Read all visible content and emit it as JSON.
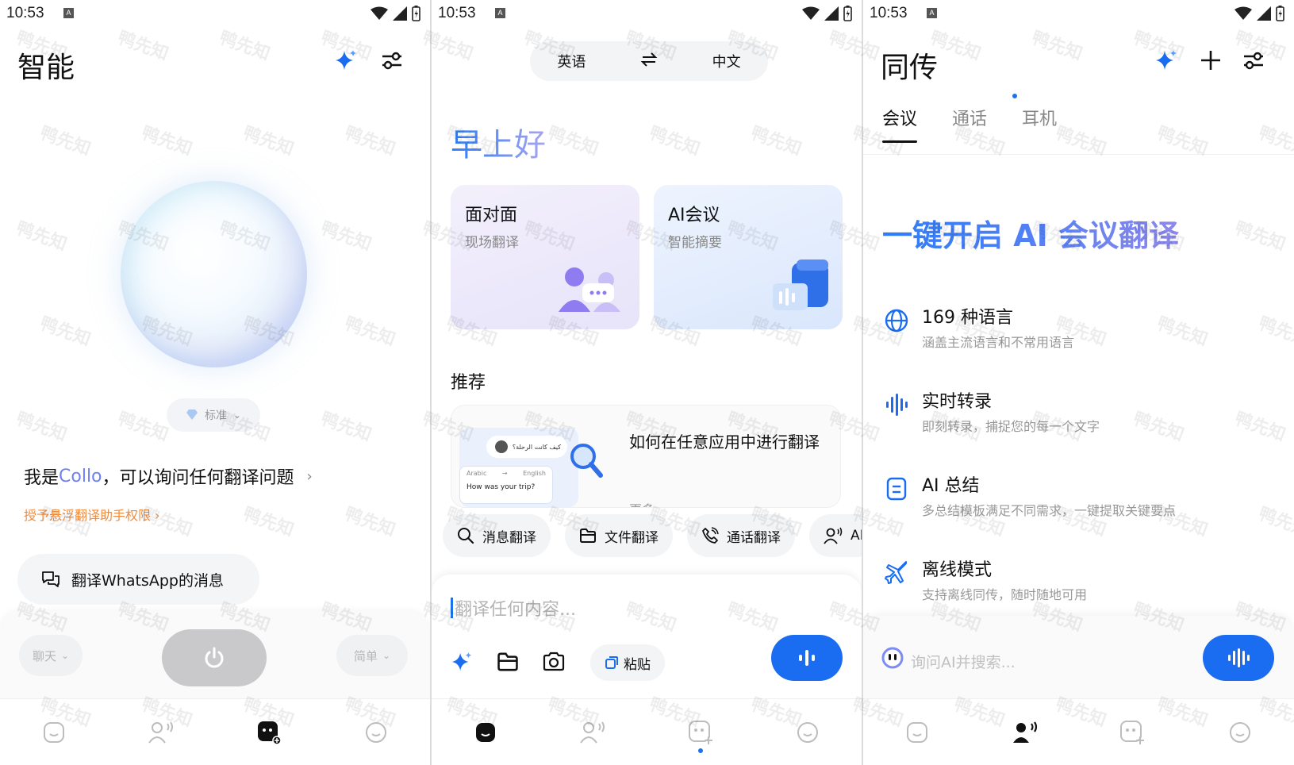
{
  "watermark": "鸭先知",
  "status": {
    "time": "10:53",
    "badge": "A"
  },
  "colors": {
    "accent": "#1a6cf0",
    "collo": "#6e7ff7",
    "orange": "#f08a3d",
    "muted": "#999999"
  },
  "screen1": {
    "title": "智能",
    "mode_pill": "标准",
    "intro_prefix": "我是",
    "intro_name": "Collo",
    "intro_suffix": "，可以询问任何翻译问题",
    "permission_link": "授予悬浮翻译助手权限 ›",
    "suggestion": "翻译WhatsApp的消息",
    "left_pill": "聊天",
    "right_pill": "简单",
    "nav_icons": [
      "smile-tile-icon",
      "person-voice-icon",
      "chat-plus-icon",
      "smiley-icon"
    ],
    "active_nav": 2
  },
  "screen2": {
    "lang_from": "英语",
    "lang_to": "中文",
    "greeting": "早上好",
    "card_face": {
      "title": "面对面",
      "subtitle": "现场翻译"
    },
    "card_ai": {
      "title": "AI会议",
      "subtitle": "智能摘要"
    },
    "recommend_title": "推荐",
    "rec_card_text": "如何在任意应用中进行翻译",
    "rec_card_more": "更多",
    "rec_preview": {
      "arabic": "كيف كانت الرحلة؟",
      "from": "Arabic",
      "to": "English",
      "english": "How was your trip?"
    },
    "chips": [
      "消息翻译",
      "文件翻译",
      "通话翻译",
      "AI"
    ],
    "input_placeholder": "翻译任何内容...",
    "paste": "粘贴",
    "active_nav": 0
  },
  "screen3": {
    "title": "同传",
    "tabs": [
      "会议",
      "通话",
      "耳机"
    ],
    "active_tab": 0,
    "hero": "一键开启 AI 会议翻译",
    "features": [
      {
        "icon": "globe-icon",
        "title": "169 种语言",
        "subtitle": "涵盖主流语言和不常用语言"
      },
      {
        "icon": "waveform-icon",
        "title": "实时转录",
        "subtitle": "即刻转录，捕捉您的每一个文字"
      },
      {
        "icon": "document-icon",
        "title": "AI 总结",
        "subtitle": "多总结模板满足不同需求，一键提取关键要点"
      },
      {
        "icon": "airplane-icon",
        "title": "离线模式",
        "subtitle": "支持离线同传，随时随地可用"
      }
    ],
    "ask_placeholder": "询问AI并搜索...",
    "active_nav": 1
  }
}
